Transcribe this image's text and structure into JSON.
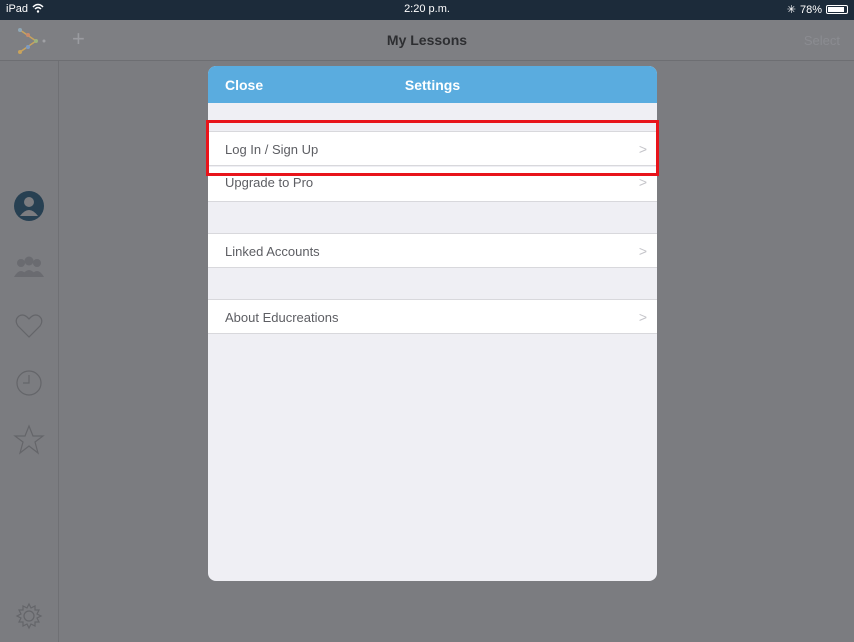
{
  "status_bar": {
    "device": "iPad",
    "time": "2:20 p.m.",
    "battery": "78%"
  },
  "header": {
    "title": "My Lessons",
    "add_icon": "+",
    "select_label": "Select"
  },
  "sidebar": {
    "items": [
      {
        "icon": "profile-icon"
      },
      {
        "icon": "group-icon"
      },
      {
        "icon": "heart-icon"
      },
      {
        "icon": "clock-icon"
      },
      {
        "icon": "star-icon"
      },
      {
        "icon": "gear-icon"
      }
    ]
  },
  "modal": {
    "close_label": "Close",
    "title": "Settings",
    "rows": [
      {
        "label": "Log In / Sign Up",
        "chevron": ">"
      },
      {
        "label": "Upgrade to Pro",
        "chevron": ">"
      },
      {
        "label": "Linked Accounts",
        "chevron": ">"
      },
      {
        "label": "About Educreations",
        "chevron": ">"
      }
    ]
  },
  "colors": {
    "accent": "#5aacdf",
    "highlight": "#e8141b",
    "overlay": "#7b7c80"
  }
}
